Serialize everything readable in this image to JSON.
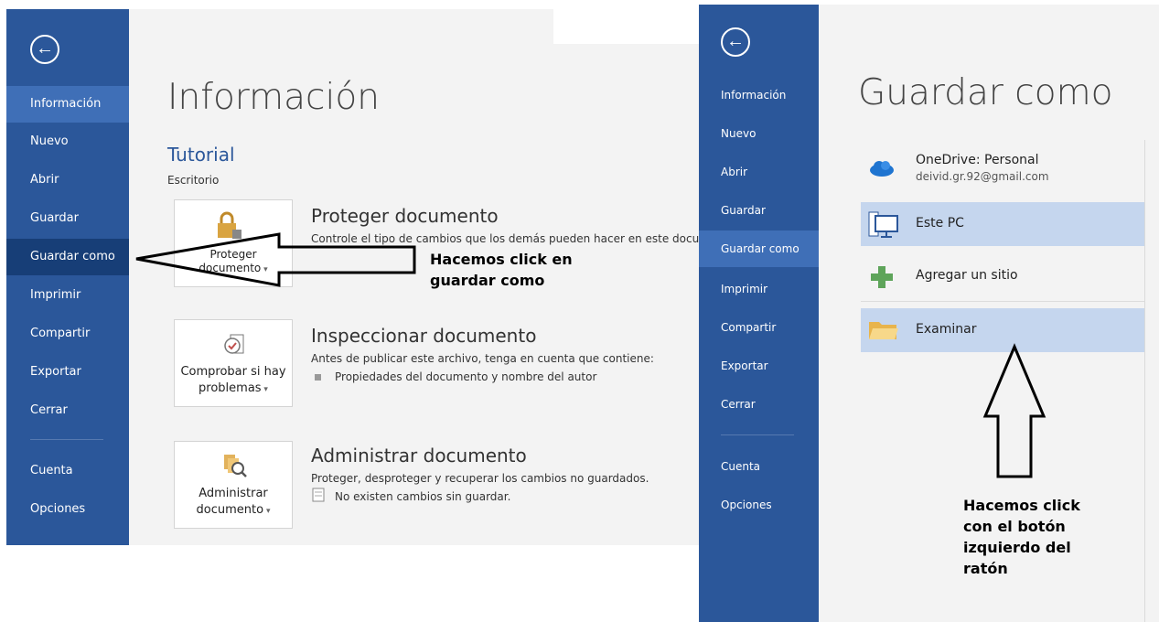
{
  "left": {
    "nav": [
      "Información",
      "Nuevo",
      "Abrir",
      "Guardar",
      "Guardar como",
      "Imprimir",
      "Compartir",
      "Exportar",
      "Cerrar"
    ],
    "nav_bottom": [
      "Cuenta",
      "Opciones"
    ],
    "title": "Información",
    "doc_name": "Tutorial",
    "doc_location": "Escritorio",
    "sections": [
      {
        "button": "Proteger documento",
        "button_l1": "Proteger",
        "button_l2": "documento",
        "heading": "Proteger documento",
        "desc": "Controle el tipo de cambios que los demás pueden hacer en este documento"
      },
      {
        "button_l1": "Comprobar si hay",
        "button_l2": "problemas",
        "heading": "Inspeccionar documento",
        "desc": "Antes de publicar este archivo, tenga en cuenta que contiene:",
        "bullet": "Propiedades del documento y nombre del autor"
      },
      {
        "button_l1": "Administrar",
        "button_l2": "documento",
        "heading": "Administrar documento",
        "desc": "Proteger, desproteger y recuperar los cambios no guardados.",
        "note": "No existen cambios sin guardar."
      }
    ],
    "annotation_l1": "Hacemos click en",
    "annotation_l2": "guardar como"
  },
  "right": {
    "nav": [
      "Información",
      "Nuevo",
      "Abrir",
      "Guardar",
      "Guardar como",
      "Imprimir",
      "Compartir",
      "Exportar",
      "Cerrar"
    ],
    "nav_bottom": [
      "Cuenta",
      "Opciones"
    ],
    "title": "Guardar como",
    "locations": {
      "onedrive": "OneDrive: Personal",
      "onedrive_email": "deivid.gr.92@gmail.com",
      "pc": "Este PC",
      "add": "Agregar un sitio",
      "browse": "Examinar"
    },
    "annotation": [
      "Hacemos click",
      "con el botón",
      "izquierdo del",
      "ratón"
    ]
  },
  "colors": {
    "sidebar": "#2b579a",
    "selected": "#3f6fb7",
    "accent": "#2b579a"
  }
}
